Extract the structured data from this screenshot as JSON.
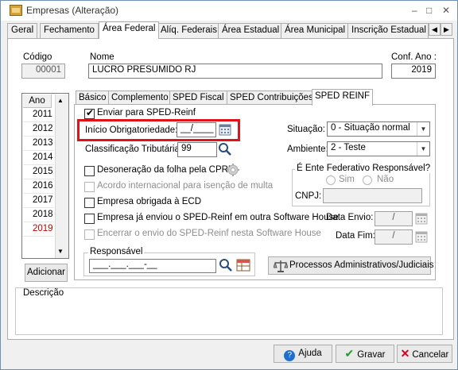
{
  "window": {
    "title": "Empresas (Alteração)",
    "minimize": "–",
    "maximize": "□",
    "close": "✕"
  },
  "main_tabs": [
    "Geral",
    "Fechamento",
    "Área Federal",
    "Alíq. Federais",
    "Área Estadual",
    "Área Municipal",
    "Inscrição Estadual S"
  ],
  "tab_scroll": {
    "left": "◀",
    "right": "▶"
  },
  "header": {
    "codigo_label": "Código",
    "codigo_value": "00001",
    "nome_label": "Nome",
    "nome_value": "LUCRO PRESUMIDO RJ",
    "conf_ano_label": "Conf. Ano :",
    "conf_ano_value": "2019"
  },
  "year_list": {
    "header": "Ano",
    "items": [
      "2011",
      "2012",
      "2013",
      "2014",
      "2015",
      "2016",
      "2017",
      "2018",
      "2019"
    ],
    "selected": "2019",
    "add_button_label": "Adicionar"
  },
  "inner_tabs": [
    "Básico",
    "Complemento",
    "SPED Fiscal",
    "SPED Contribuições",
    "SPED REINF"
  ],
  "reinf": {
    "enviar_label": "Enviar para SPED-Reinf",
    "inicio_label": "Início Obrigatoriedade:",
    "inicio_value": "__/____",
    "classificacao_label": "Classificação Tributária:",
    "classificacao_value": "99",
    "situacao_label": "Situação:",
    "situacao_value": "0 - Situação normal",
    "ambiente_label": "Ambiente:",
    "ambiente_value": "2 - Teste",
    "desoneracao_label": "Desoneração da folha pela CPRB",
    "acordo_label": "Acordo internacional para isenção de multa",
    "ecd_label": "Empresa obrigada à ECD",
    "ja_enviou_label": "Empresa já enviou o SPED-Reinf em outra Software House",
    "encerrar_label": "Encerrar o envio do SPED-Reinf nesta Software House",
    "ente_group_label": "É Ente Federativo Responsável?",
    "sim_label": "Sim",
    "nao_label": "Não",
    "cnpj_label": "CNPJ:",
    "data_envio_label": "Data Envio:",
    "data_envio_value": "/",
    "data_fim_label": "Data Fim:",
    "data_fim_value": "/",
    "responsavel_label": "Responsável",
    "responsavel_value": "___.___.___-__",
    "processos_button_label": "Processos Administrativos/Judiciais"
  },
  "descricao_label": "Descrição",
  "footer": {
    "ajuda_label": "Ajuda",
    "gravar_label": "Gravar",
    "cancelar_label": "Cancelar"
  },
  "colors": {
    "highlight": "#e0131b",
    "selected_year": "#c00000",
    "accent": "#1f6fd0"
  }
}
